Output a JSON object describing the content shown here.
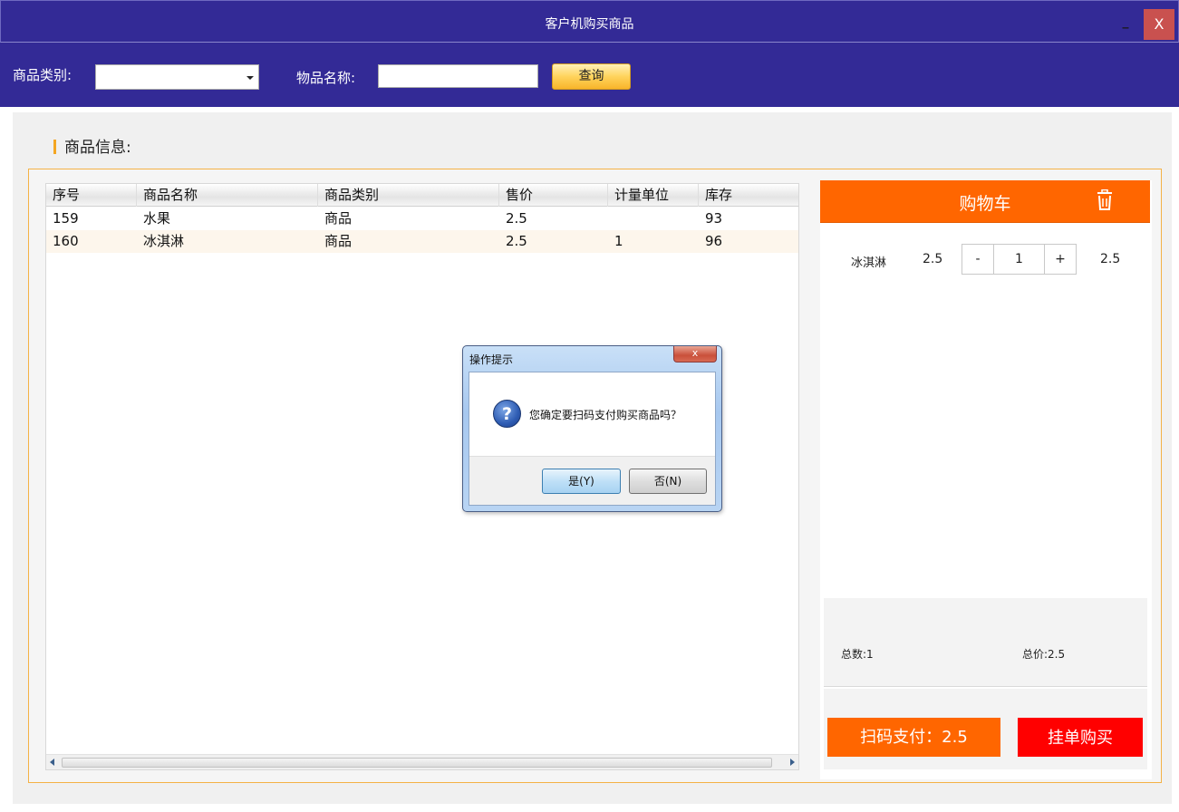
{
  "window": {
    "title": "客户机购买商品",
    "minimize_label": "_",
    "close_label": "X"
  },
  "toolbar": {
    "category_label": "商品类别:",
    "category_value": "",
    "name_label": "物品名称:",
    "name_value": "",
    "query_label": "查询"
  },
  "section": {
    "title": "商品信息:"
  },
  "table": {
    "columns": [
      "序号",
      "商品名称",
      "商品类别",
      "售价",
      "计量单位",
      "库存"
    ],
    "rows": [
      {
        "id": "159",
        "name": "水果",
        "category": "商品",
        "price": "2.5",
        "unit": "",
        "stock": "93"
      },
      {
        "id": "160",
        "name": "冰淇淋",
        "category": "商品",
        "price": "2.5",
        "unit": "1",
        "stock": "96"
      }
    ]
  },
  "cart": {
    "title": "购物车",
    "items": [
      {
        "name": "冰淇淋",
        "price": "2.5",
        "minus": "-",
        "qty": "1",
        "plus": "+",
        "subtotal": "2.5"
      }
    ],
    "count_text": "总数:1",
    "total_text": "总价:2.5",
    "pay_label": "扫码支付：2.5",
    "hold_label": "挂单购买"
  },
  "dialog": {
    "title": "操作提示",
    "close_label": "x",
    "icon": "question-icon",
    "icon_glyph": "?",
    "message": "您确定要扫码支付购买商品吗？",
    "yes_label": "是(Y)",
    "no_label": "否(N)"
  },
  "colors": {
    "header_bg": "#332a96",
    "accent_orange": "#ff6600",
    "hold_red": "#ff0000",
    "query_gold": "#ffd35c",
    "close_red": "#c9514f"
  }
}
